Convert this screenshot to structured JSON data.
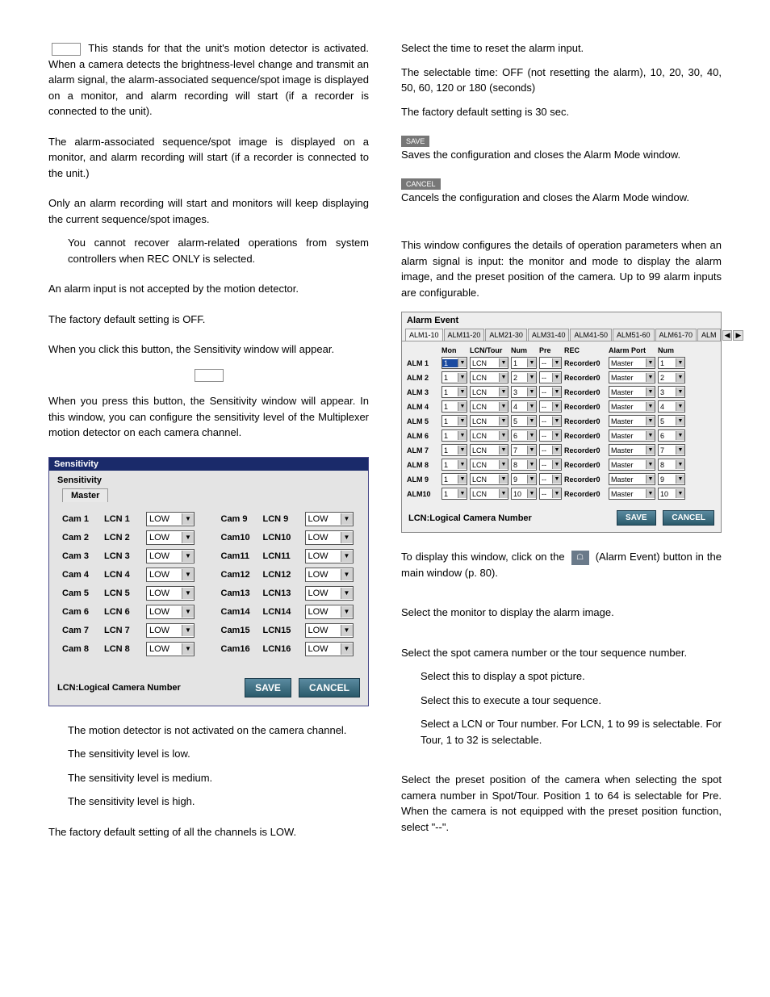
{
  "left": {
    "p1_prefix_box": true,
    "p1": "This stands for that the unit's motion detector is activated. When a camera detects the brightness-level change and transmit an alarm signal, the alarm-associated sequence/spot image is displayed on a monitor, and alarm recording will start (if a recorder is connected to the unit).",
    "p2": "The alarm-associated sequence/spot image is displayed on a monitor, and alarm recording will start (if a recorder is connected to the unit.)",
    "p3": "Only an alarm recording will start and monitors will keep displaying the current sequence/spot images.",
    "p3_note": "You cannot recover alarm-related operations from system controllers when REC ONLY is selected.",
    "p4": "An alarm input is not accepted by the motion detector.",
    "p5": "The factory default setting is OFF.",
    "p6": "When you click this button, the Sensitivity window will appear.",
    "p7": "When you press this button, the Sensitivity window will appear. In this window, you can configure the sensitivity level of the Multiplexer motion detector on each camera channel.",
    "sens": {
      "title": "Sensitivity",
      "group": "Sensitivity",
      "tab": "Master",
      "left": [
        {
          "cam": "Cam 1",
          "lcn": "LCN 1",
          "val": "LOW"
        },
        {
          "cam": "Cam 2",
          "lcn": "LCN 2",
          "val": "LOW"
        },
        {
          "cam": "Cam 3",
          "lcn": "LCN 3",
          "val": "LOW"
        },
        {
          "cam": "Cam 4",
          "lcn": "LCN 4",
          "val": "LOW"
        },
        {
          "cam": "Cam 5",
          "lcn": "LCN 5",
          "val": "LOW"
        },
        {
          "cam": "Cam 6",
          "lcn": "LCN 6",
          "val": "LOW"
        },
        {
          "cam": "Cam 7",
          "lcn": "LCN 7",
          "val": "LOW"
        },
        {
          "cam": "Cam 8",
          "lcn": "LCN 8",
          "val": "LOW"
        }
      ],
      "right": [
        {
          "cam": "Cam 9",
          "lcn": "LCN 9",
          "val": "LOW"
        },
        {
          "cam": "Cam10",
          "lcn": "LCN10",
          "val": "LOW"
        },
        {
          "cam": "Cam11",
          "lcn": "LCN11",
          "val": "LOW"
        },
        {
          "cam": "Cam12",
          "lcn": "LCN12",
          "val": "LOW"
        },
        {
          "cam": "Cam13",
          "lcn": "LCN13",
          "val": "LOW"
        },
        {
          "cam": "Cam14",
          "lcn": "LCN14",
          "val": "LOW"
        },
        {
          "cam": "Cam15",
          "lcn": "LCN15",
          "val": "LOW"
        },
        {
          "cam": "Cam16",
          "lcn": "LCN16",
          "val": "LOW"
        }
      ],
      "note": "LCN:Logical Camera Number",
      "save": "SAVE",
      "cancel": "CANCEL"
    },
    "levels": {
      "off": "The motion detector is not activated on the camera channel.",
      "low": "The sensitivity level is low.",
      "mid": "The sensitivity level is medium.",
      "high": "The sensitivity level is high."
    },
    "p8": "The factory default setting of all the channels is LOW."
  },
  "right": {
    "p1": "Select the time to reset the alarm input.",
    "p2": "The selectable time: OFF (not resetting the alarm), 10, 20, 30, 40, 50, 60, 120 or 180 (seconds)",
    "p3": "The factory default setting is 30 sec.",
    "save_chip": "SAVE",
    "p4": "Saves the configuration and closes the Alarm Mode window.",
    "cancel_chip": "CANCEL",
    "p5": "Cancels the configuration and closes the Alarm Mode window.",
    "p6": "This window configures the details of operation parameters when an alarm signal is input: the monitor and mode to display the alarm image, and the preset position of the camera. Up to 99 alarm inputs are configurable.",
    "alarm": {
      "title": "Alarm Event",
      "tabs": [
        "ALM1-10",
        "ALM11-20",
        "ALM21-30",
        "ALM31-40",
        "ALM41-50",
        "ALM51-60",
        "ALM61-70",
        "ALM"
      ],
      "head": [
        "",
        "Mon",
        "LCN/Tour",
        "Num",
        "Pre",
        "REC",
        "Alarm Port",
        "Num"
      ],
      "rows": [
        {
          "label": "ALM 1",
          "mon": "1",
          "lt": "LCN",
          "num": "1",
          "pre": "--",
          "rec": "Recorder0",
          "port": "Master",
          "pnum": "1",
          "hl": true
        },
        {
          "label": "ALM 2",
          "mon": "1",
          "lt": "LCN",
          "num": "2",
          "pre": "--",
          "rec": "Recorder0",
          "port": "Master",
          "pnum": "2"
        },
        {
          "label": "ALM 3",
          "mon": "1",
          "lt": "LCN",
          "num": "3",
          "pre": "--",
          "rec": "Recorder0",
          "port": "Master",
          "pnum": "3"
        },
        {
          "label": "ALM 4",
          "mon": "1",
          "lt": "LCN",
          "num": "4",
          "pre": "--",
          "rec": "Recorder0",
          "port": "Master",
          "pnum": "4"
        },
        {
          "label": "ALM 5",
          "mon": "1",
          "lt": "LCN",
          "num": "5",
          "pre": "--",
          "rec": "Recorder0",
          "port": "Master",
          "pnum": "5"
        },
        {
          "label": "ALM 6",
          "mon": "1",
          "lt": "LCN",
          "num": "6",
          "pre": "--",
          "rec": "Recorder0",
          "port": "Master",
          "pnum": "6"
        },
        {
          "label": "ALM 7",
          "mon": "1",
          "lt": "LCN",
          "num": "7",
          "pre": "--",
          "rec": "Recorder0",
          "port": "Master",
          "pnum": "7"
        },
        {
          "label": "ALM 8",
          "mon": "1",
          "lt": "LCN",
          "num": "8",
          "pre": "--",
          "rec": "Recorder0",
          "port": "Master",
          "pnum": "8"
        },
        {
          "label": "ALM 9",
          "mon": "1",
          "lt": "LCN",
          "num": "9",
          "pre": "--",
          "rec": "Recorder0",
          "port": "Master",
          "pnum": "9"
        },
        {
          "label": "ALM10",
          "mon": "1",
          "lt": "LCN",
          "num": "10",
          "pre": "--",
          "rec": "Recorder0",
          "port": "Master",
          "pnum": "10"
        }
      ],
      "note": "LCN:Logical Camera Number",
      "save": "SAVE",
      "cancel": "CANCEL"
    },
    "p7a": "To display this window, click on the ",
    "p7b": " (Alarm Event) button in the main window (p. 80).",
    "p8": "Select the monitor to display the alarm image.",
    "p9": "Select the spot camera number or the tour sequence number.",
    "p9a": "Select this to display a spot picture.",
    "p9b": "Select this to execute a tour sequence.",
    "p9c": "Select a LCN or Tour number. For LCN, 1 to 99 is selectable. For Tour, 1 to 32 is selectable.",
    "p10": "Select the preset position of the camera when selecting the spot camera number in Spot/Tour. Position 1 to 64 is selectable for Pre. When the camera is not equipped with the preset position function, select \"--\"."
  }
}
